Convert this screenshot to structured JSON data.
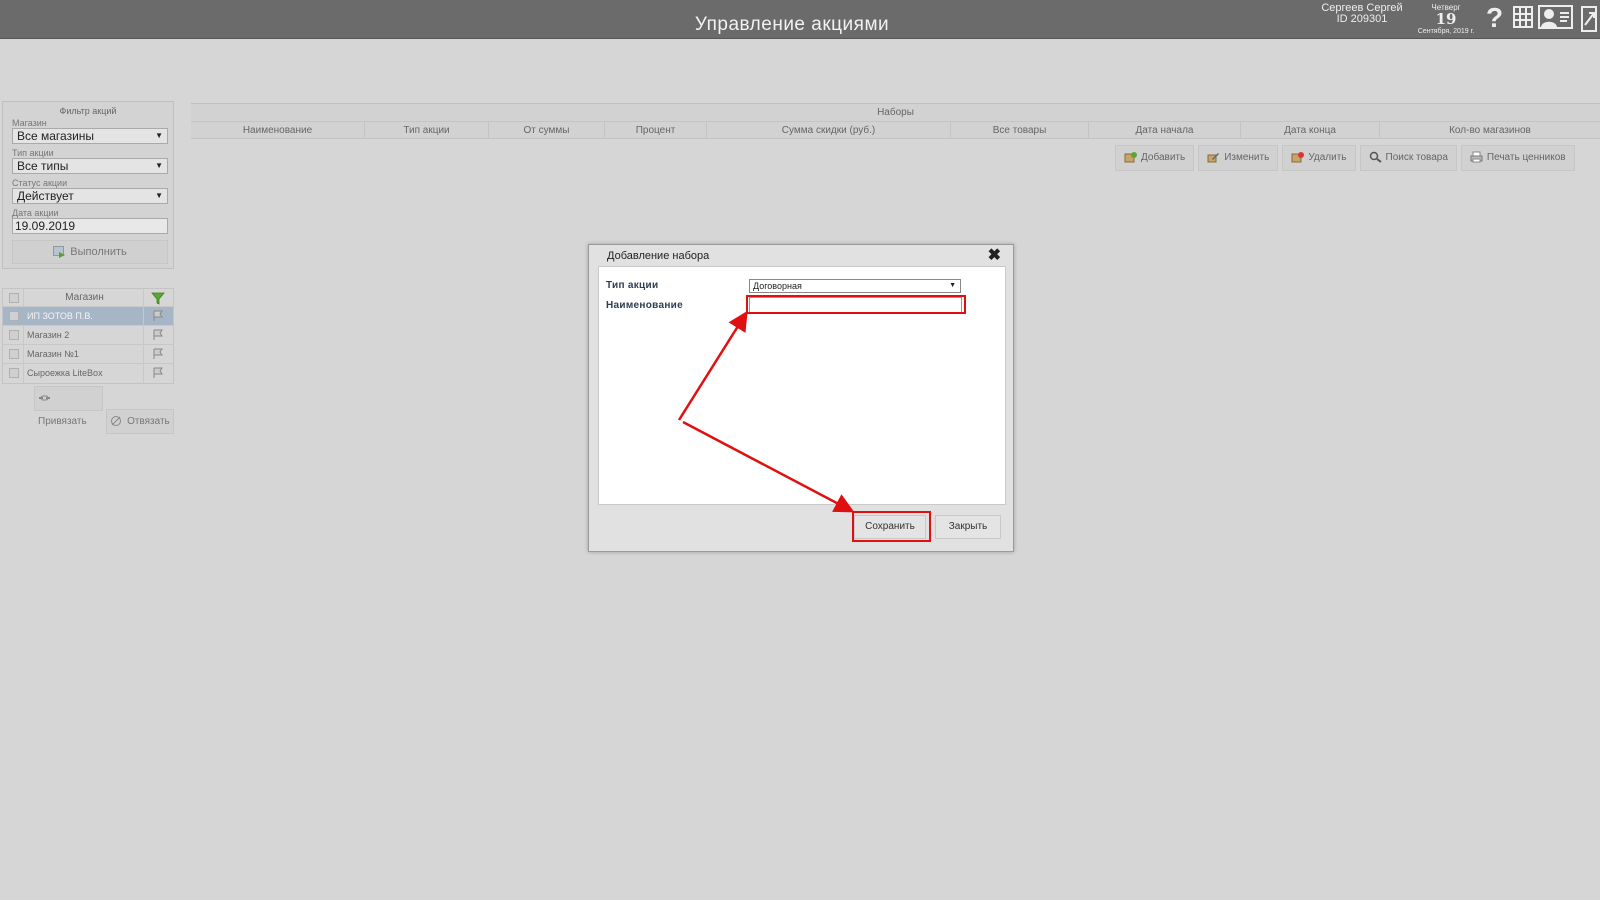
{
  "header": {
    "title": "Управление акциями",
    "user_name": "Сергеев Сергей",
    "user_id": "ID 209301",
    "weekday": "Четверг",
    "day": "19",
    "month_year": "Сентября, 2019 г.",
    "help_glyph": "?",
    "icons": [
      "help-icon",
      "grid-icon",
      "user-card-icon",
      "exit-icon"
    ]
  },
  "filter": {
    "title": "Фильтр акций",
    "store_label": "Магазин",
    "store_value": "Все магазины",
    "type_label": "Тип акции",
    "type_value": "Все типы",
    "status_label": "Статус акции",
    "status_value": "Действует",
    "date_label": "Дата акции",
    "date_value": "19.09.2019",
    "run_label": "Выполнить"
  },
  "stores": {
    "header": "Магазин",
    "rows": [
      {
        "name": "ИП ЗОТОВ П.В.",
        "selected": true
      },
      {
        "name": "Магазин 2",
        "selected": false
      },
      {
        "name": "Магазин №1",
        "selected": false
      },
      {
        "name": "Сыроежка LiteBox",
        "selected": false
      }
    ],
    "bind_label": "Привязать",
    "unbind_label": "Отвязать"
  },
  "sets": {
    "title": "Наборы",
    "columns": [
      "Наименование",
      "Тип акции",
      "От суммы",
      "Процент",
      "Сумма скидки (руб.)",
      "Все товары",
      "Дата начала",
      "Дата конца",
      "Кол-во магазинов"
    ],
    "toolbar": {
      "add": "Добавить",
      "edit": "Изменить",
      "delete": "Удалить",
      "search": "Поиск товара",
      "print": "Печать ценников"
    }
  },
  "dialog": {
    "title": "Добавление набора",
    "close_glyph": "✖",
    "type_label": "Тип акции",
    "type_value": "Договорная",
    "name_label": "Наименование",
    "name_value": "",
    "save_label": "Сохранить",
    "close_label": "Закрыть"
  },
  "annotation_color": "#e01010"
}
